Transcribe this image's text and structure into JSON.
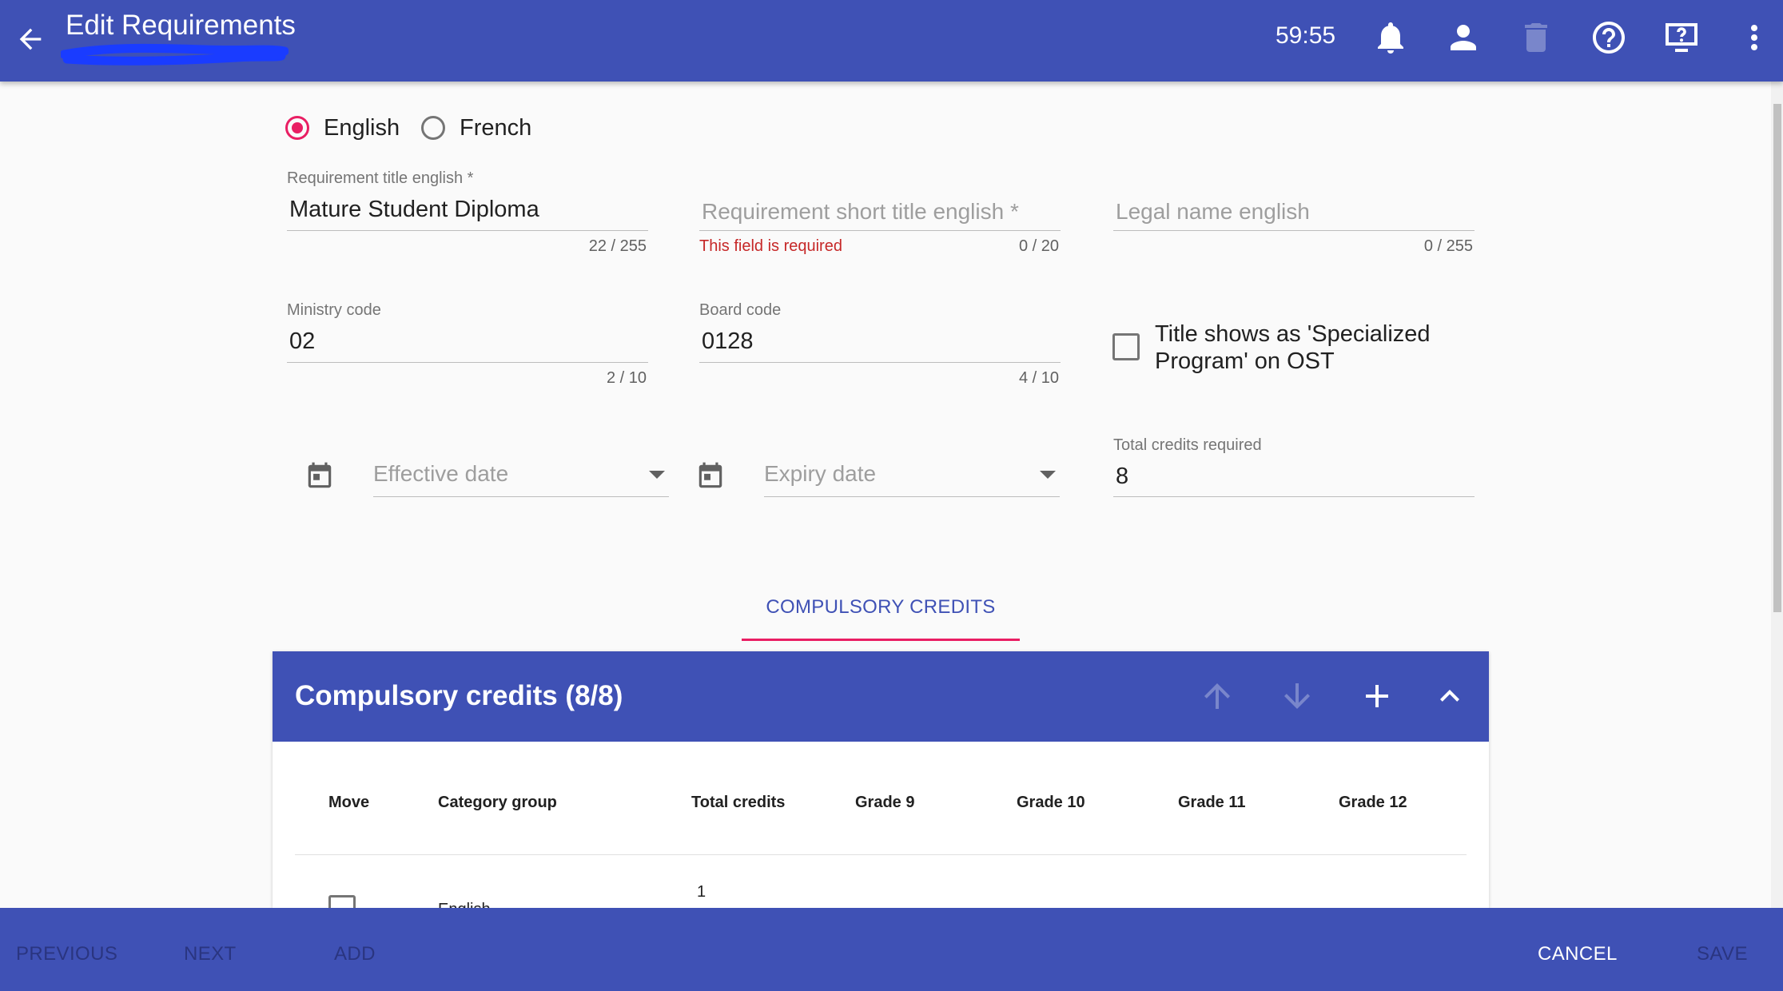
{
  "header": {
    "title": "Edit Requirements",
    "timer": "59:55",
    "icons": [
      "arrow-back-icon",
      "bell-icon",
      "person-icon",
      "trash-icon",
      "help-icon",
      "screen-help-icon",
      "more-vert-icon"
    ]
  },
  "language": {
    "options": [
      {
        "label": "English",
        "selected": true
      },
      {
        "label": "French",
        "selected": false
      }
    ]
  },
  "fields": {
    "title_english": {
      "label": "Requirement title english *",
      "value": "Mature Student Diploma",
      "counter": "22 / 255"
    },
    "short_title_english": {
      "placeholder": "Requirement short title english *",
      "error": "This field is required",
      "counter": "0 / 20"
    },
    "legal_name_english": {
      "placeholder": "Legal name english",
      "counter": "0 / 255"
    },
    "ministry_code": {
      "label": "Ministry code",
      "value": "02",
      "counter": "2 / 10"
    },
    "board_code": {
      "label": "Board code",
      "value": "0128",
      "counter": "4 / 10"
    },
    "specialized_checkbox": {
      "label_line1": "Title shows as 'Specialized",
      "label_line2": "Program' on OST",
      "checked": false
    },
    "effective_date": {
      "placeholder": "Effective date"
    },
    "expiry_date": {
      "placeholder": "Expiry date"
    },
    "total_credits": {
      "label": "Total credits required",
      "value": "8"
    }
  },
  "tabs": [
    {
      "label": "COMPULSORY CREDITS",
      "active": true
    }
  ],
  "panel": {
    "title": "Compulsory credits (8/8)",
    "columns": [
      "Move",
      "Category group",
      "Total credits",
      "Grade 9",
      "Grade 10",
      "Grade 11",
      "Grade 12"
    ],
    "rows": [
      {
        "category": "English",
        "total_credits": "1"
      }
    ]
  },
  "footer": {
    "previous": "PREVIOUS",
    "next": "NEXT",
    "add": "ADD",
    "cancel": "CANCEL",
    "save": "SAVE"
  },
  "colors": {
    "primary": "#3f51b5",
    "accent": "#e91e63",
    "error": "#c62828"
  }
}
